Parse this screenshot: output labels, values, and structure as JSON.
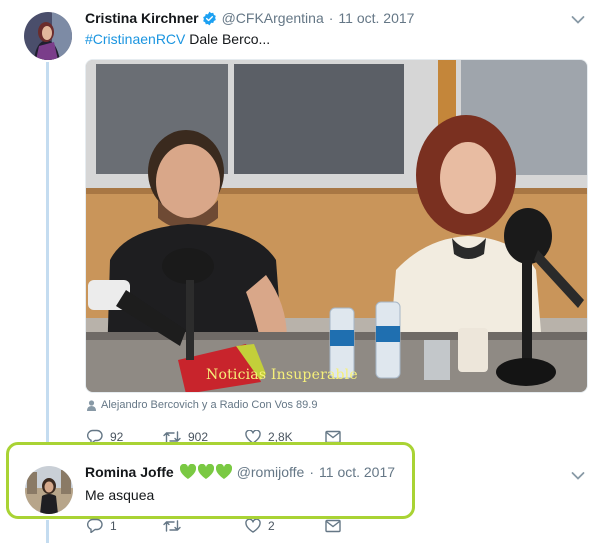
{
  "tweet1": {
    "name": "Cristina Kirchner",
    "handle": "@CFKArgentina",
    "separator": "·",
    "date": "11 oct. 2017",
    "hashtag": "#CristinaenRCV",
    "text": " Dale Berco...",
    "watermark": "Noticias Insuperable",
    "tagged": "Alejandro Bercovich y a Radio Con Vos 89.9",
    "reply_count": "92",
    "retweet_count": "902",
    "like_count": "2,8K",
    "icons": [
      "reply-icon",
      "retweet-icon",
      "like-icon",
      "message-icon",
      "verified-badge-icon",
      "chevron-down-icon",
      "person-tag-icon"
    ]
  },
  "tweet2": {
    "name": "Romina Joffe",
    "handle": "@romijoffe",
    "separator": "·",
    "date": "11 oct. 2017",
    "text": "Me asquea",
    "reply_count": "1",
    "retweet_count": "",
    "like_count": "2",
    "name_emoji": [
      "green-heart",
      "green-heart",
      "green-heart"
    ]
  },
  "colors": {
    "link": "#1b95e0",
    "secondary_text": "#657786",
    "thread_line": "#c4dcf0",
    "highlight_border": "#a9d334",
    "green_heart": "#7ac943"
  }
}
